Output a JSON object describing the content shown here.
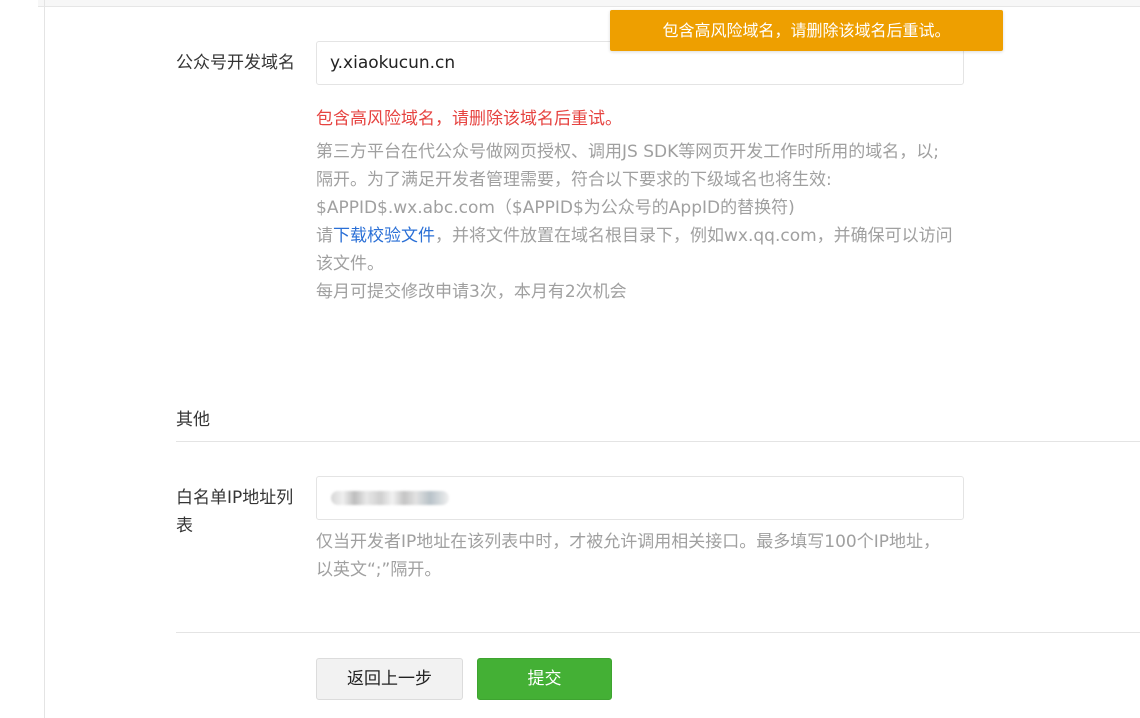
{
  "toast": {
    "message": "包含高风险域名，请删除该域名后重试。"
  },
  "domain_field": {
    "label": "公众号开发域名",
    "value": "y.xiaokucun.cn",
    "error": "包含高风险域名，请删除该域名后重试。",
    "desc_line1": "第三方平台在代公众号做网页授权、调用JS SDK等网页开发工作时所用的域名，以;",
    "desc_line2": "隔开。为了满足开发者管理需要，符合以下要求的下级域名也将生效:",
    "desc_line3": "$APPID$.wx.abc.com（$APPID$为公众号的AppID的替换符)",
    "desc_line4_prefix": "请",
    "desc_line4_link": "下载校验文件",
    "desc_line4_suffix": "，并将文件放置在域名根目录下，例如wx.qq.com，并确保可以访问",
    "desc_line5": "该文件。",
    "desc_line6": "每月可提交修改申请3次，本月有2次机会"
  },
  "other_section": {
    "title": "其他"
  },
  "whitelist_field": {
    "label_line1": "白名单IP地址列",
    "label_line2": "表",
    "desc_line1": "仅当开发者IP地址在该列表中时，才被允许调用相关接口。最多填写100个IP地址，",
    "desc_line2": "以英文“;”隔开。"
  },
  "actions": {
    "back_label": "返回上一步",
    "submit_label": "提交"
  },
  "colors": {
    "toast_bg": "#ee9f00",
    "error": "#e64340",
    "link": "#2a6fd6",
    "submit_bg": "#44b035"
  }
}
